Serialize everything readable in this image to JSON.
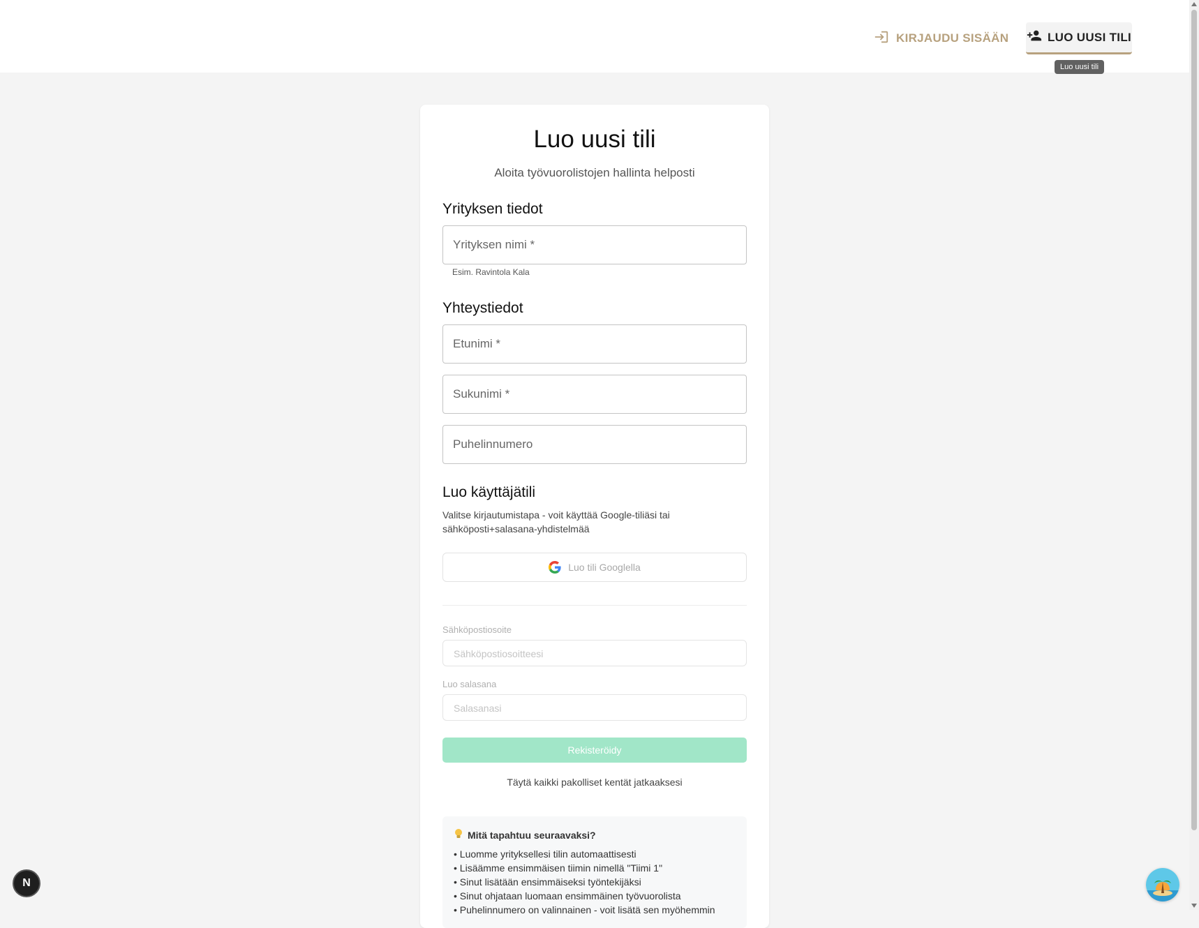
{
  "nav": {
    "login_label": "KIRJAUDU SISÄÄN",
    "signup_label": "LUO UUSI TILI",
    "tooltip": "Luo uusi tili",
    "login_icon": "login-icon",
    "signup_icon": "person-add-icon"
  },
  "form": {
    "title": "Luo uusi tili",
    "subtitle": "Aloita työvuorolistojen hallinta helposti",
    "company_section": {
      "title": "Yrityksen tiedot",
      "company_name_label": "Yrityksen nimi *",
      "company_name_helper": "Esim. Ravintola Kala"
    },
    "contact_section": {
      "title": "Yhteystiedot",
      "first_name_label": "Etunimi *",
      "last_name_label": "Sukunimi *",
      "phone_label": "Puhelinnumero"
    },
    "account_section": {
      "title": "Luo käyttäjätili",
      "description": "Valitse kirjautumistapa - voit käyttää Google-tiliäsi tai sähköposti+salasana-yhdistelmää",
      "google_button": "Luo tili Googlella",
      "email_label": "Sähköpostiosoite",
      "email_placeholder": "Sähköpostiosoitteesi",
      "password_label": "Luo salasana",
      "password_placeholder": "Salasanasi",
      "register_button": "Rekisteröidy",
      "fill_required_note": "Täytä kaikki pakolliset kentät jatkaaksesi"
    },
    "info_box": {
      "title": "Mitä tapahtuu seuraavaksi?",
      "items": [
        "• Luomme yrityksellesi tilin automaattisesti",
        "• Lisäämme ensimmäisen tiimin nimellä \"Tiimi 1\"",
        "• Sinut lisätään ensimmäiseksi työntekijäksi",
        "• Sinut ohjataan luomaan ensimmäinen työvuorolista",
        "• Puhelinnumero on valinnainen - voit lisätä sen myöhemmin"
      ]
    }
  },
  "floating": {
    "next_badge": "N"
  },
  "colors": {
    "accent": "#b7a17e",
    "register_button": "#a1e6c8",
    "background": "#f4f4f4"
  }
}
